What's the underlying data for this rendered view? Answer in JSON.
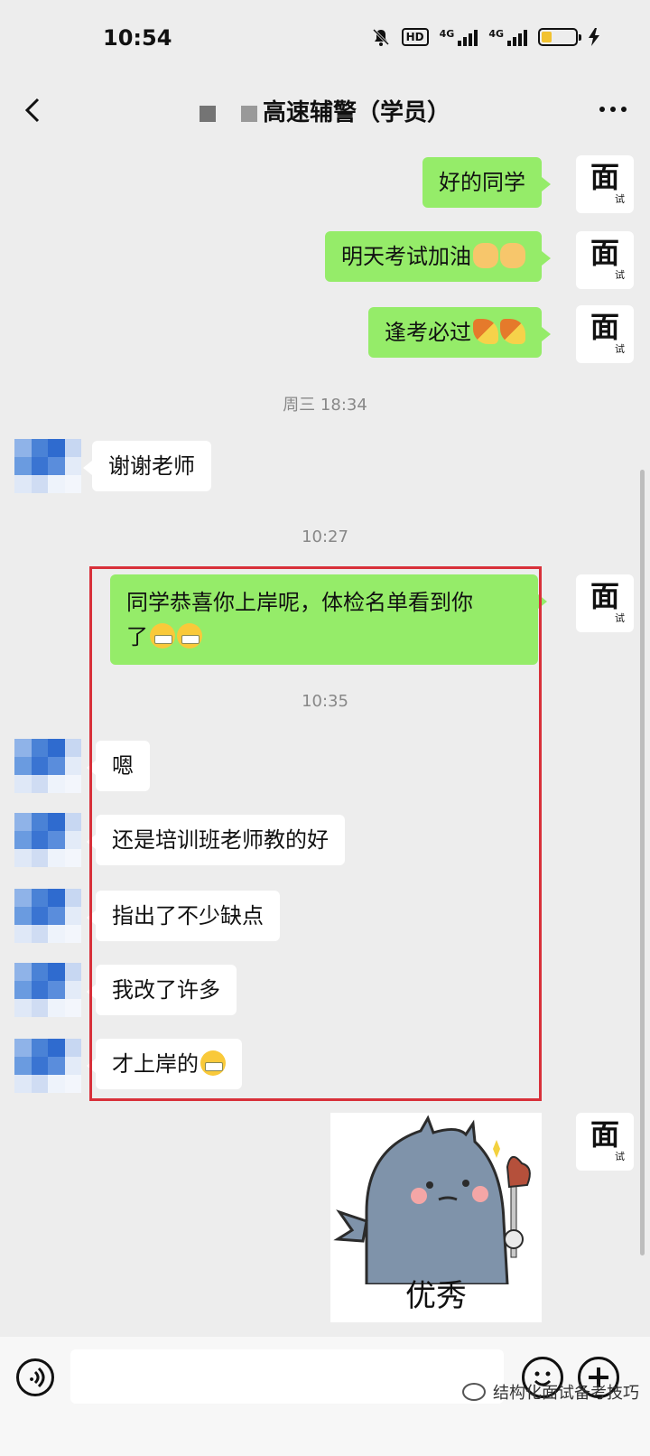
{
  "status_bar": {
    "time": "10:54",
    "hd_label": "HD",
    "network_1": "4G",
    "network_2": "4G",
    "battery_level": 0.3
  },
  "header": {
    "title": "高速辅警（学员）"
  },
  "messages": [
    {
      "side": "right",
      "text": "好的同学"
    },
    {
      "side": "right",
      "text": "明天考试加油"
    },
    {
      "side": "right",
      "text": "逢考必过"
    },
    {
      "type": "timestamp",
      "text": "周三 18:34"
    },
    {
      "side": "left",
      "text": "谢谢老师"
    },
    {
      "type": "timestamp",
      "text": "10:27"
    },
    {
      "side": "right",
      "text_line1": "同学恭喜你上岸呢，体检名单看到你",
      "text_line2": "了"
    },
    {
      "type": "timestamp",
      "text": "10:35"
    },
    {
      "side": "left",
      "text": "嗯"
    },
    {
      "side": "left",
      "text": "还是培训班老师教的好"
    },
    {
      "side": "left",
      "text": "指出了不少缺点"
    },
    {
      "side": "left",
      "text": "我改了许多"
    },
    {
      "side": "left",
      "text": "才上岸的"
    },
    {
      "side": "right",
      "type": "sticker",
      "caption": "优秀"
    }
  ],
  "avatar_right": {
    "big": "面",
    "small": "试"
  },
  "watermark": "结构化面试备考技巧",
  "colors": {
    "green_bubble": "#95ec69",
    "highlight_border": "#d8303a",
    "background": "#ededed"
  }
}
